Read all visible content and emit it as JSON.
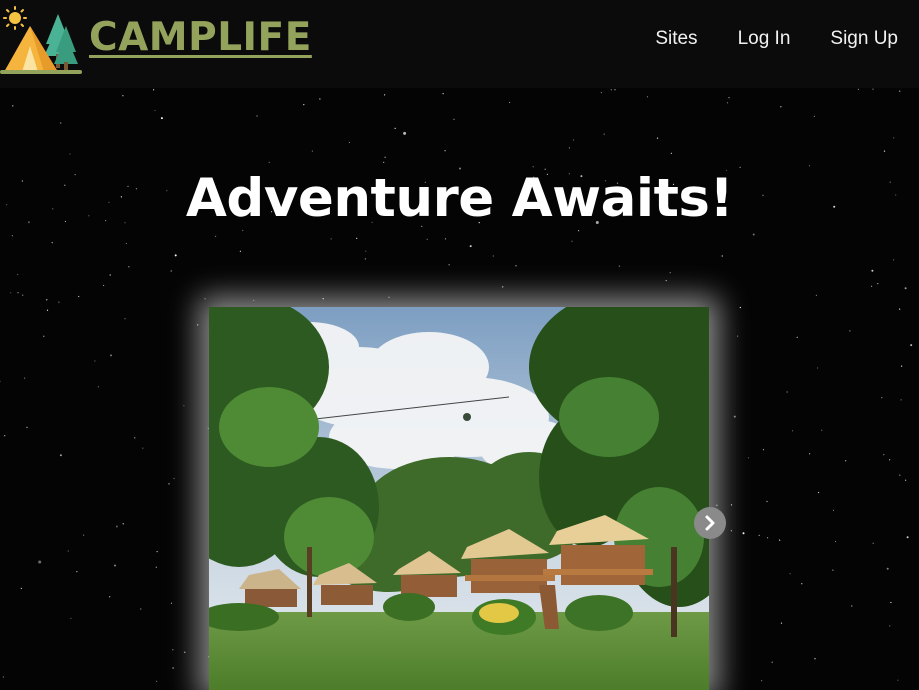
{
  "header": {
    "brand_name": "CAMPLIFE",
    "brand_logo_icon": "tent-trees-sun-logo",
    "nav": [
      {
        "label": "Sites"
      },
      {
        "label": "Log In"
      },
      {
        "label": "Sign Up"
      }
    ],
    "brand_color": "#94a35c",
    "background": "#0b0b0b"
  },
  "hero": {
    "title": "Adventure Awaits!",
    "background": "starry-night-sky"
  },
  "carousel": {
    "slide_image": "glamping-tents-in-jungle-photo",
    "next_icon": "chevron-right-icon"
  }
}
